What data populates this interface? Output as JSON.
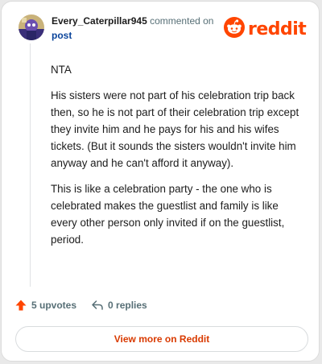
{
  "comment": {
    "author": "Every_Caterpillar945",
    "action_text": "commented on",
    "post_link": "post",
    "paragraphs": [
      "NTA",
      "His sisters were not part of his celebration trip back then, so he is not part of their celebration trip except they invite him and he pays for his and his wifes tickets. (But it sounds the sisters wouldn't invite him anyway and he can't afford it anyway).",
      "This is like a celebration party - the one who is celebrated makes the guestlist and family is like every other person only invited if on the guestlist, period."
    ]
  },
  "brand": {
    "name": "reddit",
    "color": "#ff4500"
  },
  "actions": {
    "upvotes_label": "5 upvotes",
    "replies_label": "0 replies"
  },
  "view_more_label": "View more on Reddit",
  "icons": {
    "upvote": "upvote-arrow-icon",
    "reply": "reply-arrow-icon",
    "logo": "reddit-alien-icon",
    "avatar": "user-avatar"
  }
}
